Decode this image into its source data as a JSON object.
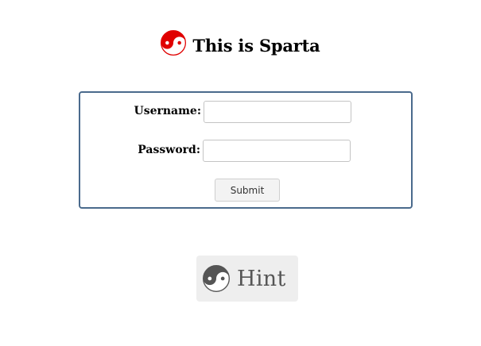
{
  "header": {
    "title": "This is Sparta",
    "icon": "yin-yang-icon",
    "icon_color": "#e00000"
  },
  "login_form": {
    "border_color": "#4a6a8c",
    "username_label": "Username:",
    "username_value": "",
    "password_label": "Password:",
    "password_value": "",
    "submit_label": "Submit"
  },
  "hint": {
    "label": "Hint",
    "icon": "yin-yang-icon",
    "icon_color": "#555555"
  }
}
